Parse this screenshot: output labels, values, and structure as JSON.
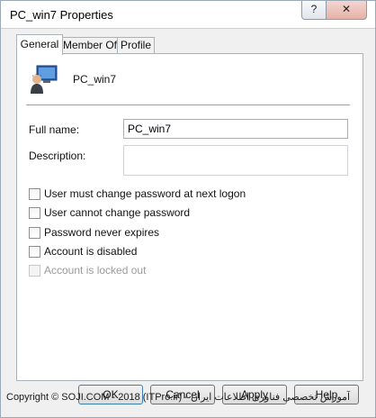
{
  "window": {
    "title": "PC_win7 Properties",
    "help_button": "?",
    "close_button": "✕"
  },
  "tabs": [
    {
      "label": "General",
      "active": true
    },
    {
      "label": "Member Of",
      "active": false
    },
    {
      "label": "Profile",
      "active": false
    }
  ],
  "general": {
    "object_name": "PC_win7",
    "full_name_label": "Full name:",
    "full_name_value": "PC_win7",
    "description_label": "Description:",
    "description_value": "",
    "options": [
      {
        "label": "User must change password at next logon",
        "checked": false,
        "enabled": true
      },
      {
        "label": "User cannot change password",
        "checked": false,
        "enabled": true
      },
      {
        "label": "Password never expires",
        "checked": false,
        "enabled": true
      },
      {
        "label": "Account is disabled",
        "checked": false,
        "enabled": true
      },
      {
        "label": "Account is locked out",
        "checked": false,
        "enabled": false
      }
    ]
  },
  "buttons": {
    "ok": "OK",
    "cancel": "Cancel",
    "apply": "Apply",
    "help": "Help"
  },
  "watermark": "Copyright © SOJI.COM - 2018 (ITPro.ir) - آموزش تخصصی فناوری اطلاعات ایران"
}
